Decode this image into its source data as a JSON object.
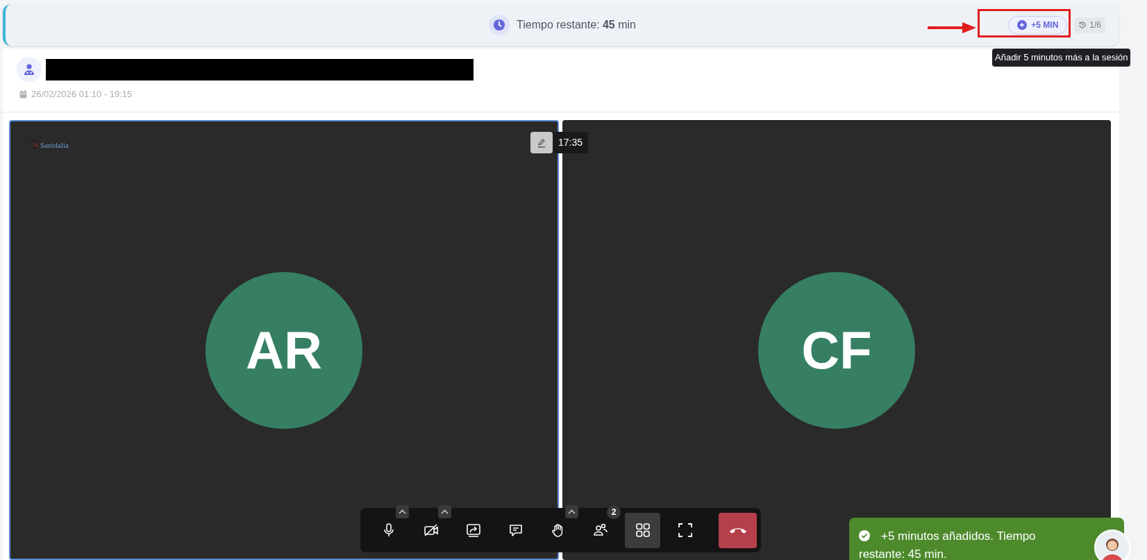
{
  "timer_bar": {
    "text": "Tiempo restante: **45** min",
    "add_button": "+5 MIN",
    "extensions": "1/6",
    "extensions_disabled": true,
    "tooltip": "Añadir 5 minutos más a la sesión"
  },
  "session": {
    "date": "26/02/2026 01:10 - 19:15"
  },
  "video_tiles": [
    {
      "initials": "AR",
      "selected": true,
      "logo": "Sanidalia",
      "time": "17:35"
    },
    {
      "initials": "CF",
      "selected": false
    }
  ],
  "toolbar": [
    {
      "kind": "mic",
      "has_menu": true,
      "selected": false
    },
    {
      "kind": "camera_off",
      "has_menu": true,
      "selected": false
    },
    {
      "kind": "share",
      "has_menu": false,
      "selected": false
    },
    {
      "kind": "chat",
      "has_menu": false,
      "selected": false
    },
    {
      "kind": "hand",
      "has_menu": true,
      "selected": false
    },
    {
      "kind": "participants",
      "has_menu": false,
      "selected": false,
      "badge": "2"
    },
    {
      "kind": "layout",
      "has_menu": false,
      "selected": true
    },
    {
      "kind": "fullscreen",
      "has_menu": false,
      "selected": false
    },
    {
      "kind": "hangup",
      "has_menu": false,
      "selected": false
    }
  ],
  "toast": {
    "message": "+5 minutos añadidos. Tiempo restante: 45 min."
  }
}
